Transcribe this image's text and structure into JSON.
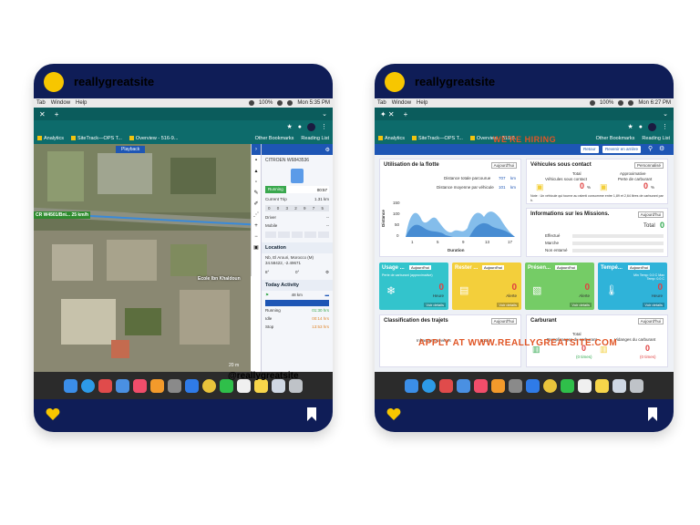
{
  "brand_name": "reallygreatsite",
  "left_screen": {
    "menubar": {
      "items": [
        "Tab",
        "Window",
        "Help"
      ],
      "battery": "100%",
      "time": "Mon 5:35 PM"
    },
    "bookmarks": [
      "Analytics",
      "SiteTrack—OPS T...",
      "Overview - 516-9...",
      "Other Bookmarks",
      "Reading List"
    ],
    "map": {
      "playback_label": "Playback",
      "road_label": "CR W4501/Bni... 25 km/h",
      "school_label": "Ecole Ibn Khaldoun",
      "scale_label": "20 m"
    },
    "panel": {
      "vehicle_id": "CITROEN W6843536",
      "status": "Running",
      "status_value": "00:57",
      "current_trip_label": "Current Trip",
      "current_trip_value": "1.31 km",
      "odometer": "0 0 3 2 9 7 5",
      "driver_label": "Driver",
      "driver_value": "--",
      "mobile_label": "Mobile",
      "mobile_value": "--",
      "location_title": "Location",
      "address": "Nb, El Arouri, Morocco (M) 34.58422, -2.49671",
      "btn_left": "8°",
      "btn_mid": "0°",
      "activity_title": "Today Activity",
      "activity_distance": "48 km",
      "activity_rows": [
        {
          "label": "Running",
          "value": "01:30 hrs"
        },
        {
          "label": "Idle",
          "value": "00:14 hrs"
        },
        {
          "label": "Stop",
          "value": "13:53 hrs"
        }
      ]
    },
    "watermark": "@reallygreatsite"
  },
  "right_screen": {
    "menubar": {
      "items": [
        "Tab",
        "Window",
        "Help"
      ],
      "battery": "100%",
      "time": "Mon 6:27 PM"
    },
    "bookmarks": [
      "Analytics",
      "SiteTrack—OPS T...",
      "Overview - 516-9...",
      "Other Bookmarks",
      "Reading List"
    ],
    "hiring_text": "WE'RE HIRING",
    "apply_text": "APPLY AT WWW.REALLYGREATSITE.COM",
    "top_buttons": [
      "Retour",
      "Revenir en arrière"
    ],
    "fleet": {
      "title": "Utilisation de la flotte",
      "period": "Aujourd'hui",
      "total_distance_label": "Distance totale parcourue",
      "total_distance_value": "707",
      "total_distance_unit": "km",
      "avg_distance_label": "Distance moyenne par véhicule",
      "avg_distance_value": "101",
      "avg_distance_unit": "km",
      "y_axis_label": "Distance",
      "x_axis_label": "Duration",
      "y_ticks": [
        "150",
        "100",
        "50",
        "0"
      ],
      "x_ticks": [
        "1",
        "5",
        "9",
        "13",
        "17"
      ]
    },
    "contact": {
      "title": "Véhicules sous contact",
      "period": "Personnalisé",
      "total_label": "Total",
      "total_sub": "Véhicules sous contact",
      "approx_label": "Approximative",
      "approx_sub": "Perte de carburant",
      "left_value": "0",
      "left_pct": "%",
      "right_value": "0",
      "right_pct": "%",
      "note": "Note : Un véhicule qui tourne au ralenti consomme entre 1,89 et 2,64 litres de carburant par h."
    },
    "missions": {
      "title": "Informations sur les Missions.",
      "period": "Aujourd'hui",
      "total_label": "Total",
      "total_value": "0",
      "rows": [
        "Effectué",
        "Marche",
        "Non entamé"
      ]
    },
    "tiles": [
      {
        "title": "Usage ...",
        "period": "Aujourd'hui",
        "sub_top": "Perte de carburant (approximative)",
        "value": "0",
        "unit": "Heure",
        "foot": "Voir details",
        "color": "#33c4cc"
      },
      {
        "title": "Rester ...",
        "period": "Aujourd'hui",
        "sub_top": "",
        "value": "0",
        "unit": "Alerte",
        "foot": "Voir details",
        "color": "#f3cf3b"
      },
      {
        "title": "Présen...",
        "period": "Aujourd'hui",
        "sub_top": "",
        "value": "0",
        "unit": "Alerte",
        "foot": "Voir details",
        "color": "#75cc66"
      },
      {
        "title": "Tempé...",
        "period": "Aujourd'hui",
        "sub_top": "Min Temp: 0.0 C  Max Temp: 0.0 C",
        "value": "0",
        "unit": "Heure",
        "foot": "Voir details",
        "color": "#2fb3d9"
      }
    ],
    "trips": {
      "title": "Classification des trajets",
      "period": "Aujourd'hui",
      "left_label": "Infractions sévères",
      "right_label": "Total"
    },
    "fuel": {
      "title": "Carburant",
      "period": "Aujourd'hui",
      "total_label": "Total",
      "total_sub": "Remplissages du carburant",
      "right_label": "Vidanges du carburant",
      "left_value": "0",
      "left_unit": "(0 times)",
      "right_value": "0",
      "right_unit": "(0 times)"
    }
  }
}
